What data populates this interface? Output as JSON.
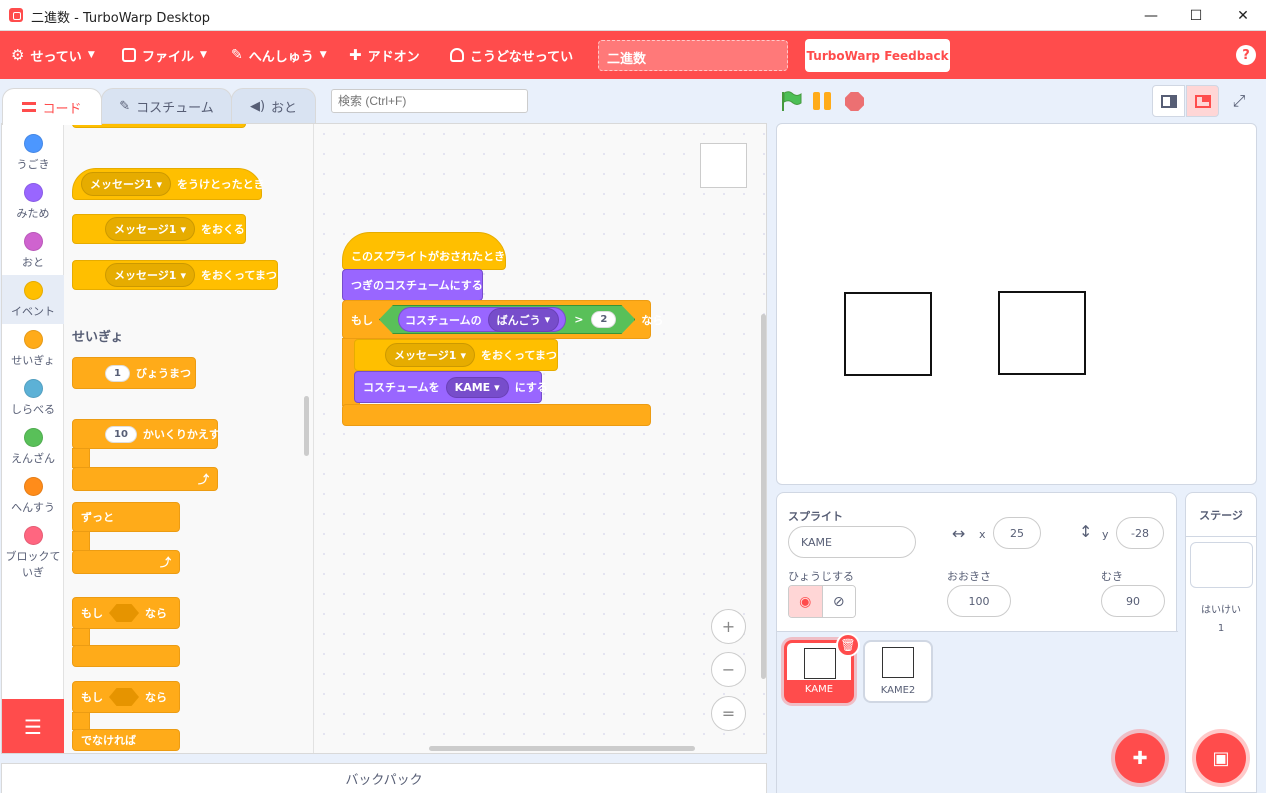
{
  "window": {
    "title": "二進数 - TurboWarp Desktop",
    "minimize": "—",
    "maximize": "☐",
    "close": "✕"
  },
  "menu": {
    "settings": "せってい",
    "file": "ファイル",
    "edit": "へんしゅう",
    "addons": "アドオン",
    "advanced": "こうどなせってい",
    "project_title": "二進数",
    "feedback": "TurboWarp Feedback",
    "help": "?"
  },
  "tabs": {
    "code": "コード",
    "costumes": "コスチューム",
    "sounds": "おと"
  },
  "search": {
    "placeholder": "検索 (Ctrl+F)"
  },
  "categories": [
    {
      "label": "うごき",
      "color": "#4c97ff"
    },
    {
      "label": "みため",
      "color": "#9966ff"
    },
    {
      "label": "おと",
      "color": "#cf63cf"
    },
    {
      "label": "イベント",
      "color": "#ffbf00"
    },
    {
      "label": "せいぎょ",
      "color": "#ffab19"
    },
    {
      "label": "しらべる",
      "color": "#5cb1d6"
    },
    {
      "label": "えんざん",
      "color": "#59c059"
    },
    {
      "label": "へんすう",
      "color": "#ff8c1a"
    },
    {
      "label": "ブロックて",
      "label2": "いぎ",
      "color": "#ff6680"
    }
  ],
  "flyout": {
    "when_receive": {
      "dropdown": "メッセージ1",
      "text": "をうけとったとき"
    },
    "broadcast": {
      "dropdown": "メッセージ1",
      "text": "をおくる"
    },
    "broadcast_wait": {
      "dropdown": "メッセージ1",
      "text": "をおくってまつ"
    },
    "control_label": "せいぎょ",
    "wait": {
      "value": "1",
      "text": "びょうまつ"
    },
    "repeat": {
      "value": "10",
      "text": "かいくりかえす"
    },
    "forever": "ずっと",
    "if_then": {
      "if": "もし",
      "then": "なら"
    },
    "if_else": {
      "if": "もし",
      "then": "なら",
      "else": "でなければ"
    }
  },
  "script": {
    "hat": "このスプライトがおされたとき",
    "next_costume": "つぎのコスチュームにする",
    "if": "もし",
    "then": "なら",
    "costume_of": "コスチュームの",
    "costume_field": "ばんごう",
    "gt": ">",
    "compare_value": "2",
    "broadcast_dropdown": "メッセージ1",
    "broadcast_text": "をおくってまつ",
    "switch_costume": "コスチュームを",
    "switch_value": "KAME",
    "switch_suffix": "にする"
  },
  "zoom": {
    "in": "+",
    "out": "−",
    "reset": "="
  },
  "backpack": "バックパック",
  "sprite_info": {
    "sprite_label": "スプライト",
    "sprite_name": "KAME",
    "x_label": "x",
    "x_value": "25",
    "y_label": "y",
    "y_value": "-28",
    "show_label": "ひょうじする",
    "size_label": "おおきさ",
    "size_value": "100",
    "direction_label": "むき",
    "direction_value": "90"
  },
  "sprites": [
    {
      "name": "KAME"
    },
    {
      "name": "KAME2"
    }
  ],
  "stage_pane": {
    "title": "ステージ",
    "backdrops_label": "はいけい",
    "backdrops_count": "1"
  },
  "colors": {
    "accent": "#ff4c4c",
    "events": "#ffbf00",
    "control": "#ffab19",
    "looks": "#9966ff",
    "operators": "#59c059"
  }
}
